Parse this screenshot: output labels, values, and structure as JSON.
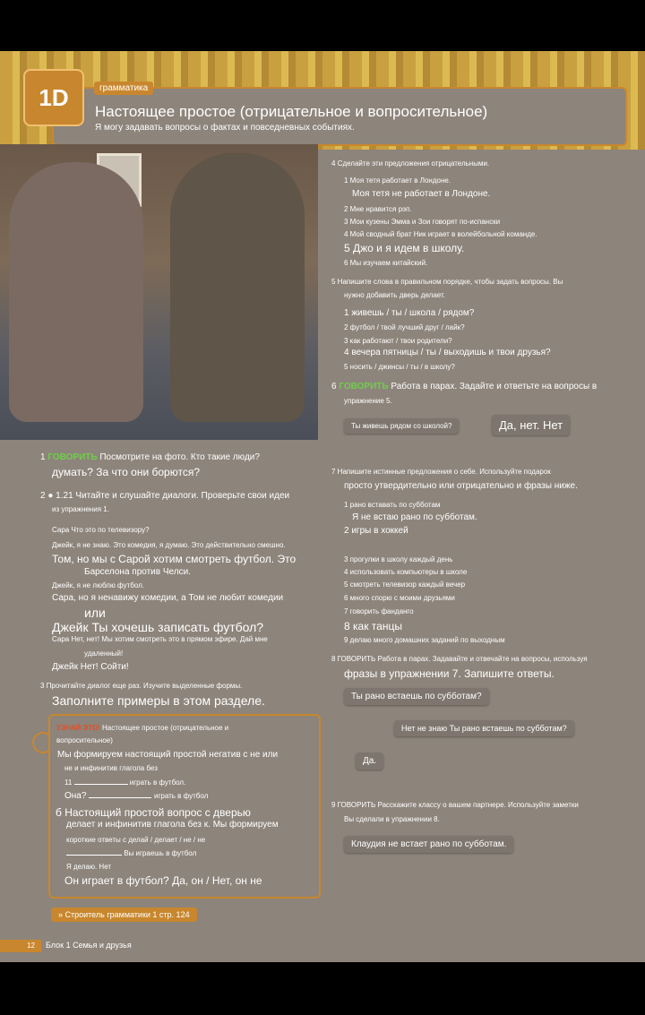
{
  "header": {
    "unit_badge": "1D",
    "section_tag": "грамматика",
    "title": "Настоящее простое (отрицательное и вопросительное)",
    "subtitle": "Я могу задавать вопросы о фактах и повседневных событиях."
  },
  "left": {
    "ex1": {
      "num": "1",
      "speak": "ГОВОРИТЬ",
      "line1": "Посмотрите на фото.  Кто такие люди?",
      "line2": "думать?  За что они борются?"
    },
    "ex2": {
      "num": "2",
      "audio": "1.21",
      "line1": "Читайте и слушайте диалоги.  Проверьте свои идеи",
      "line2": "из упражнения 1."
    },
    "dialogue": [
      "Сара Что это по телевизору?",
      "Джейк, я не знаю.  Это комедия, я думаю.  Это действительно смешно.",
      "Том, но мы с Сарой хотим смотреть футбол.  Это",
      "Барселона против Челси.",
      "Джейк, я не люблю футбол.",
      "Сара, но я ненавижу комедии, а Том не любит комедии",
      "или",
      "Джейк Ты хочешь записать футбол?",
      "Сара Нет, нет!  Мы хотим смотреть это в прямом эфире.  Дай мне",
      "удаленный!",
      "Джейк Нет!  Сойти!"
    ],
    "ex3": {
      "line1": "3 Прочитайте диалог еще раз.  Изучите выделенные формы.",
      "line2": "Заполните примеры в этом разделе."
    },
    "learn": {
      "heading": "УЗНАЙ ЭТО!",
      "heading_rest": "Настоящее простое (отрицательное и",
      "heading_line2": "вопросительное)",
      "a1": "Мы формируем настоящий простой негатив с не или",
      "a2": "не и инфинитив глагола без",
      "a3": "11",
      "a3b": "играть в футбол.",
      "a4": "Она?",
      "a4b": "играть в футбол",
      "b1": "б Настоящий простой вопрос с дверью",
      "b2": "делает и инфинитив глагола без к.  Мы формируем",
      "b3": "короткие ответы с делай / делает / не / не",
      "b4": "Вы играешь в футбол",
      "b5": "Я делаю.  Нет",
      "b6": "Он играет в футбол?  Да, он / Нет, он не"
    },
    "grammar_ref": "» Строитель грамматики 1 стр. 124"
  },
  "right": {
    "ex4": {
      "instr": "4 Сделайте эти предложения отрицательными.",
      "items": [
        "1 Моя тетя работает в Лондоне.",
        "Моя тетя не работает в Лондоне.",
        "2 Мне нравится рэп.",
        "3 Мои кузены Эмма и Зои говорят по-испански",
        "4 Мой сводный брат Ник играет в волейбольной команде.",
        "5 Джо и я идем в школу.",
        "6 Мы изучаем китайский."
      ]
    },
    "ex5": {
      "instr1": "5 Напишите слова в правильном порядке, чтобы задать вопросы.  Вы",
      "instr2": "нужно добавить дверь делает.",
      "items": [
        "1 живешь / ты / школа / рядом?",
        "2 футбол / твой лучший друг / лайк?",
        "3 как работают / твои родители?",
        "4 вечера пятницы / ты / выходишь и твои друзья?",
        "5 носить / джинсы / ты / в школу?"
      ]
    },
    "ex6": {
      "num": "6",
      "speak": "ГОВОРИТЬ",
      "text": "Работа в парах.  Задайте и ответьте на вопросы в",
      "line2": "упражнение 5."
    },
    "ex6_bubbles": {
      "q": "Ты живешь рядом со школой?",
      "a": "Да, нет. Нет"
    },
    "ex7": {
      "instr1": "7 Напишите истинные предложения о себе.  Используйте подарок",
      "instr2": "просто утвердительно или отрицательно и фразы ниже.",
      "items": [
        "1 рано вставать по субботам",
        "Я не встаю рано по субботам.",
        "2 игры в хоккей",
        "3 прогулки в школу каждый день",
        "4 использовать компьютеры в школе",
        "5 смотреть телевизор каждый вечер",
        "6 много спорю с моими друзьями",
        "7 говорить фанданго",
        "8 как танцы",
        "9 делаю много домашних заданий по выходным"
      ]
    },
    "ex8": {
      "instr1": "8 ГОВОРИТЬ Работа в парах.  Задавайте и отвечайте на вопросы, используя",
      "instr2": "фразы в упражнении 7. Запишите ответы."
    },
    "ex8_bubbles": {
      "q": "Ты рано встаешь по субботам?",
      "a": "Нет не знаю Ты рано встаешь по субботам?",
      "c": "Да."
    },
    "ex9": {
      "instr1": "9 ГОВОРИТЬ Расскажите классу о вашем партнере.  Используйте заметки",
      "instr2": "Вы сделали в упражнении 8."
    },
    "ex9_bubble": "Клаудия не встает рано по субботам."
  },
  "footer": {
    "page": "12",
    "label": "Блок 1 Семья и друзья"
  }
}
